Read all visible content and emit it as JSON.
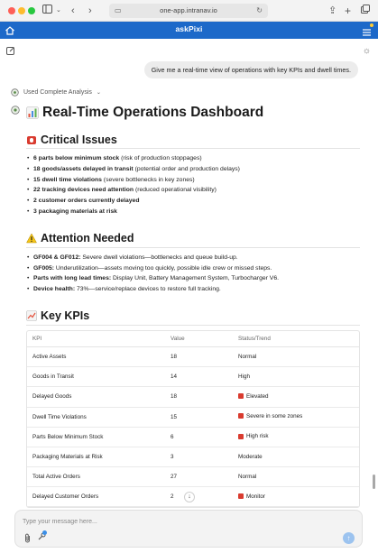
{
  "browser": {
    "url": "one-app.intranav.io"
  },
  "app": {
    "title": "askPixi"
  },
  "user_message": "Give me a real-time view of operations with key KPIs and dwell times.",
  "analysis_label": "Used Complete Analysis",
  "dashboard": {
    "title": "Real-Time Operations Dashboard",
    "critical": {
      "title": "Critical Issues",
      "items": [
        {
          "bold": "6 parts below minimum stock",
          "rest": " (risk of production stoppages)"
        },
        {
          "bold": "18 goods/assets delayed in transit",
          "rest": " (potential order and production delays)"
        },
        {
          "bold": "15 dwell time violations",
          "rest": " (severe bottlenecks in key zones)"
        },
        {
          "bold": "22 tracking devices need attention",
          "rest": " (reduced operational visibility)"
        },
        {
          "bold": "2 customer orders currently delayed",
          "rest": ""
        },
        {
          "bold": "3 packaging materials at risk",
          "rest": ""
        }
      ]
    },
    "attention": {
      "title": "Attention Needed",
      "items": [
        {
          "bold": "GF004 & GF012:",
          "rest": " Severe dwell violations—bottlenecks and queue build-up."
        },
        {
          "bold": "GF005:",
          "rest": " Underutilization—assets moving too quickly, possible idle crew or missed steps."
        },
        {
          "bold": "Parts with long lead times:",
          "rest": " Display Unit, Battery Management System, Turbocharger V6."
        },
        {
          "bold": "Device health:",
          "rest": " 73%—service/replace devices to restore full tracking."
        }
      ]
    },
    "kpis": {
      "title": "Key KPIs",
      "headers": [
        "KPI",
        "Value",
        "Status/Trend"
      ],
      "rows": [
        {
          "kpi": "Active Assets",
          "value": "18",
          "status": "Normal",
          "flag": false
        },
        {
          "kpi": "Goods in Transit",
          "value": "14",
          "status": "High",
          "flag": false
        },
        {
          "kpi": "Delayed Goods",
          "value": "18",
          "status": "Elevated",
          "flag": true
        },
        {
          "kpi": "Dwell Time Violations",
          "value": "15",
          "status": "Severe in some zones",
          "flag": true
        },
        {
          "kpi": "Parts Below Minimum Stock",
          "value": "6",
          "status": "High risk",
          "flag": true
        },
        {
          "kpi": "Packaging Materials at Risk",
          "value": "3",
          "status": "Moderate",
          "flag": false
        },
        {
          "kpi": "Total Active Orders",
          "value": "27",
          "status": "Normal",
          "flag": false
        },
        {
          "kpi": "Delayed Customer Orders",
          "value": "2",
          "status": "Monitor",
          "flag": true
        }
      ]
    }
  },
  "composer": {
    "placeholder": "Type your message here..."
  },
  "colors": {
    "header_blue": "#1d69c9",
    "flag_red": "#d93b2f"
  }
}
